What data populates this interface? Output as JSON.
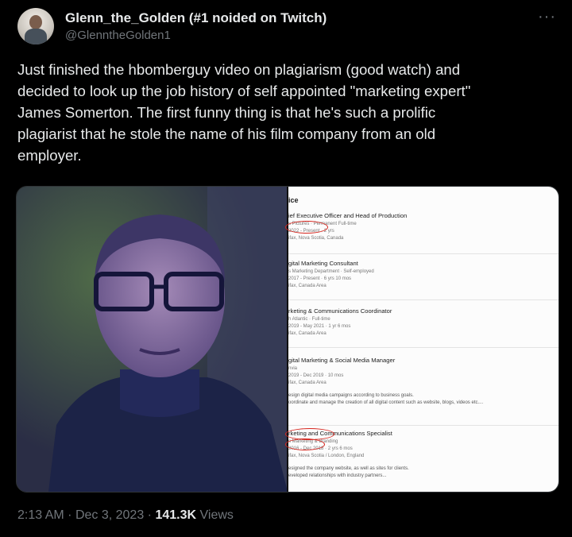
{
  "tweet": {
    "display_name": "Glenn_the_Golden (#1 noided on Twitch)",
    "handle": "@GlenntheGolden1",
    "more_label": "···",
    "text": "Just finished the hbomberguy video on plagiarism (good watch) and\ndecided to look up the job history of self appointed \"marketing expert\"\nJames Somerton. The first funny thing is that he's such a prolific\nplagiarist that he stole the name of his film company from an old\nemployer.",
    "time": "2:13 AM",
    "sep1": "·",
    "date": "Dec 3, 2023",
    "sep2": "·",
    "views_count": "141.3K",
    "views_label": "Views"
  },
  "media": {
    "resume": {
      "heading": "ice",
      "entries": [
        {
          "title": "ief Executive Officer and Head of Production",
          "company": "s Pictures · Permanent Full-time",
          "dates": "2022 - Present · 2 yrs",
          "location": "ifax, Nova Scotia, Canada",
          "desc": []
        },
        {
          "title": "gital Marketing Consultant",
          "company": "s Marketing Department · Self-employed",
          "dates": "2017 - Present · 6 yrs 10 mos",
          "location": "ifax, Canada Area",
          "desc": []
        },
        {
          "title": "rketing & Communications Coordinator",
          "company": "h Atlantic · Full-time",
          "dates": "2019 - May 2021 · 1 yr 6 mos",
          "location": "ifax, Canada Area",
          "desc": []
        },
        {
          "title": "gital Marketing & Social Media Manager",
          "company": "nvia",
          "dates": "2019 - Dec 2019 · 10 mos",
          "location": "ifax, Canada Area",
          "desc": [
            "esign digital media campaigns according to business goals.",
            "oordinate and manage the creation of all digital content such as website, blogs, videos etc...."
          ]
        },
        {
          "title": "rketing and Communications Specialist",
          "company": "s Marketing & Branding",
          "dates": "2016 - Dec 2018 · 2 yrs 6 mos",
          "location": "ifax, Nova Scotia / London, England",
          "desc": [
            "esigned the company website, as well as sites for clients.",
            "eveloped relationships with industry partners..."
          ]
        }
      ]
    }
  }
}
